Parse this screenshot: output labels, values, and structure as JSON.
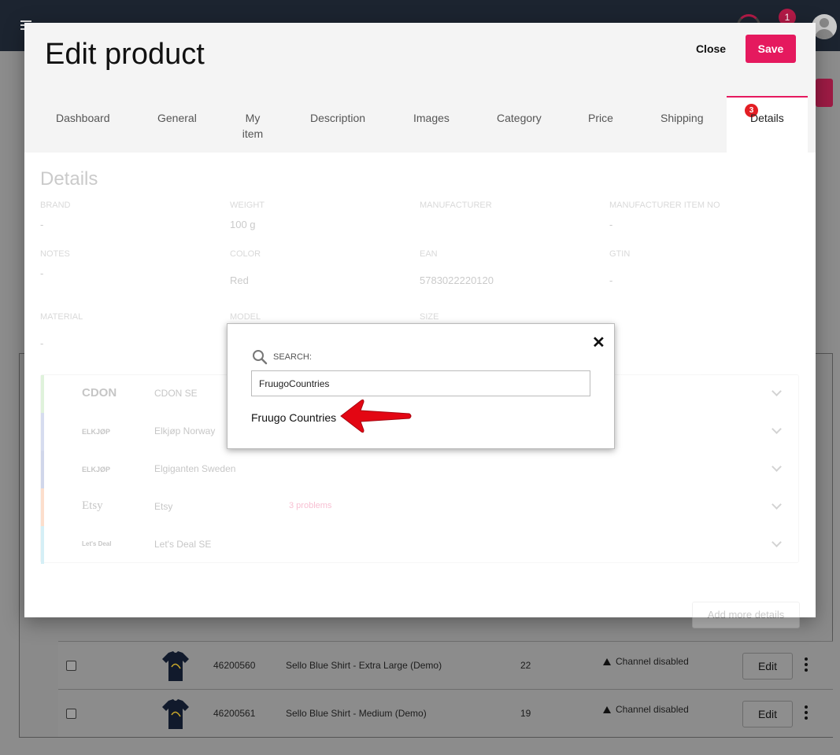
{
  "background": {
    "notification_count": "1",
    "rows": [
      {
        "sku": "46200560",
        "name": "Sello Blue Shirt - Extra Large (Demo)",
        "qty": "22",
        "status": "Channel disabled",
        "edit": "Edit"
      },
      {
        "sku": "46200561",
        "name": "Sello Blue Shirt - Medium (Demo)",
        "qty": "19",
        "status": "Channel disabled",
        "edit": "Edit"
      }
    ]
  },
  "modal": {
    "title": "Edit product",
    "close_label": "Close",
    "save_label": "Save",
    "tabs": [
      "Dashboard",
      "General",
      "My item",
      "Description",
      "Images",
      "Category",
      "Price",
      "Shipping"
    ],
    "active_tab": {
      "label": "Details",
      "badge": "3"
    },
    "section_title": "Details",
    "fields": {
      "brand": {
        "label": "BRAND",
        "value": "-"
      },
      "weight": {
        "label": "WEIGHT",
        "value": "100 g"
      },
      "manufacturer": {
        "label": "MANUFACTURER",
        "value": ""
      },
      "manufacturer_item_no": {
        "label": "MANUFACTURER ITEM NO",
        "value": "-"
      },
      "notes": {
        "label": "NOTES",
        "value": "-"
      },
      "color": {
        "label": "COLOR",
        "value": "Red"
      },
      "ean": {
        "label": "EAN",
        "value": "5783022220120"
      },
      "gtin": {
        "label": "GTIN",
        "value": "-"
      },
      "material": {
        "label": "MATERIAL",
        "value": "-"
      },
      "model": {
        "label": "MODEL",
        "value": ""
      },
      "size": {
        "label": "SIZE",
        "value": ""
      }
    },
    "channels": [
      {
        "logo": "CDON",
        "name": "CDON SE",
        "problems": "",
        "color": "#8fd17f"
      },
      {
        "logo": "ELKJØP",
        "name": "Elkjøp Norway",
        "problems": "",
        "color": "#6f84c9"
      },
      {
        "logo": "ELKJØP",
        "name": "Elgiganten Sweden",
        "problems": "",
        "color": "#5b6fb5"
      },
      {
        "logo": "Etsy",
        "name": "Etsy",
        "problems": "3 problems",
        "color": "#f58a4b"
      },
      {
        "logo": "Let's Deal",
        "name": "Let's Deal SE",
        "problems": "",
        "color": "#6cc9e0"
      }
    ],
    "add_more_label": "Add more details"
  },
  "search_popup": {
    "label": "SEARCH:",
    "input_value": "FruugoCountries",
    "result": "Fruugo Countries",
    "close_glyph": "✕"
  },
  "colors": {
    "accent": "#e5195e",
    "badge": "#e31e24",
    "arrow": "#e30613"
  }
}
